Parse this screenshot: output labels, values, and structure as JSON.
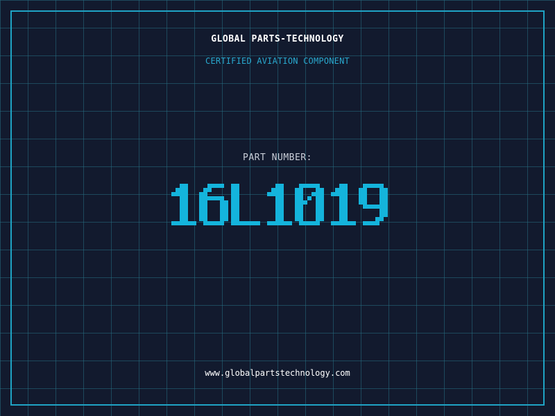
{
  "header": {
    "brand": "GLOBAL PARTS-TECHNOLOGY",
    "subtitle": "CERTIFIED AVIATION COMPONENT"
  },
  "part": {
    "label": "PART NUMBER:",
    "number": "16L1019"
  },
  "footer": {
    "website": "www.globalpartstechnology.com"
  },
  "colors": {
    "background": "#121a2e",
    "grid": "#266e82",
    "frame": "#1fa3c4",
    "accent": "#14b4dc",
    "label": "#c9ced8",
    "text": "#ffffff"
  }
}
